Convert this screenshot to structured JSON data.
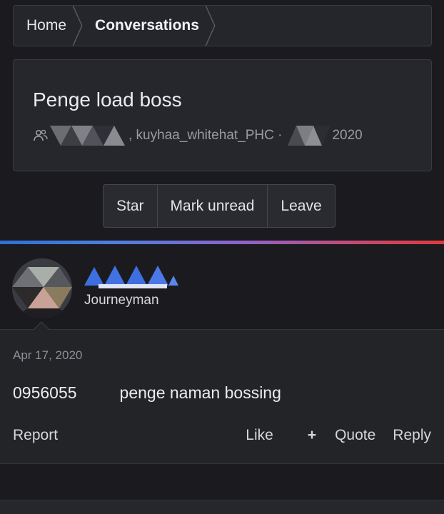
{
  "breadcrumb": {
    "items": [
      "Home",
      "Conversations"
    ]
  },
  "conversation": {
    "title": "Penge load boss",
    "participants_visible": ", kuyhaa_whitehat_PHC ·",
    "year": "2020",
    "icon": "users-icon"
  },
  "actions": {
    "star": "Star",
    "mark_unread": "Mark unread",
    "leave": "Leave"
  },
  "message": {
    "user_title": "Journeyman",
    "date": "Apr 17, 2020",
    "text_start": "0956055",
    "text_end": "penge naman bossing",
    "report": "Report",
    "like": "Like",
    "quote": "Quote",
    "reply": "Reply"
  },
  "colors": {
    "background": "#1b1b1f",
    "card": "#26272c",
    "accent_gradient_start": "#2f6fd6",
    "accent_gradient_end": "#e03a3a",
    "username_blue": "#3d6fe0"
  }
}
